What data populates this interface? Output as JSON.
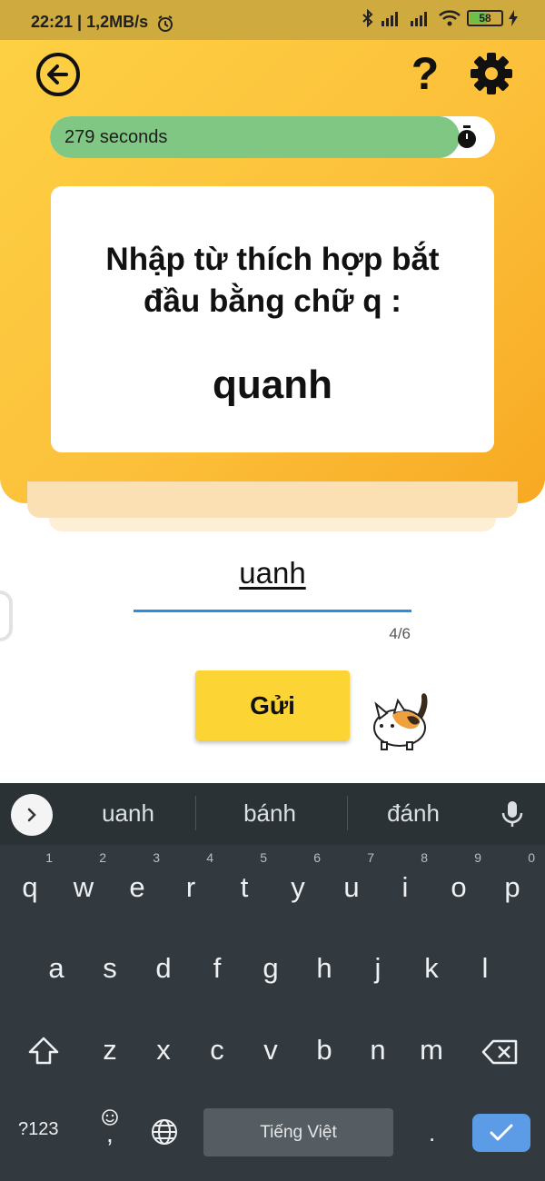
{
  "status_bar": {
    "time_speed": "22:21 | 1,2MB/s",
    "battery_level": "58",
    "battery_fraction": 0.58
  },
  "header": {
    "icons": {
      "back": "arrow-left-circle-icon",
      "help": "question-mark-icon",
      "settings": "gear-icon"
    },
    "help_label": "?"
  },
  "timer": {
    "text": "279 seconds",
    "remaining_fraction": 0.92,
    "icon": "stopwatch-icon",
    "fill_color": "#80c783"
  },
  "card": {
    "prompt": "Nhập từ thích hợp bắt đầu bằng chữ q :",
    "target_word": "quanh"
  },
  "answer": {
    "value": "uanh",
    "counter": "4/6",
    "underline_color": "#2a8de0"
  },
  "submit": {
    "label": "Gửi",
    "color": "#fcd535"
  },
  "keyboard": {
    "suggestions": [
      "uanh",
      "bánh",
      "đánh"
    ],
    "row1": [
      {
        "k": "q",
        "n": "1"
      },
      {
        "k": "w",
        "n": "2"
      },
      {
        "k": "e",
        "n": "3"
      },
      {
        "k": "r",
        "n": "4"
      },
      {
        "k": "t",
        "n": "5"
      },
      {
        "k": "y",
        "n": "6"
      },
      {
        "k": "u",
        "n": "7"
      },
      {
        "k": "i",
        "n": "8"
      },
      {
        "k": "o",
        "n": "9"
      },
      {
        "k": "p",
        "n": "0"
      }
    ],
    "row2": [
      "a",
      "s",
      "d",
      "f",
      "g",
      "h",
      "j",
      "k",
      "l"
    ],
    "row3": [
      "z",
      "x",
      "c",
      "v",
      "b",
      "n",
      "m"
    ],
    "symbols_label": "?123",
    "comma_label": ",",
    "period_label": ".",
    "space_label": "Tiếng Việt",
    "enter_color": "#5c9ce6"
  }
}
